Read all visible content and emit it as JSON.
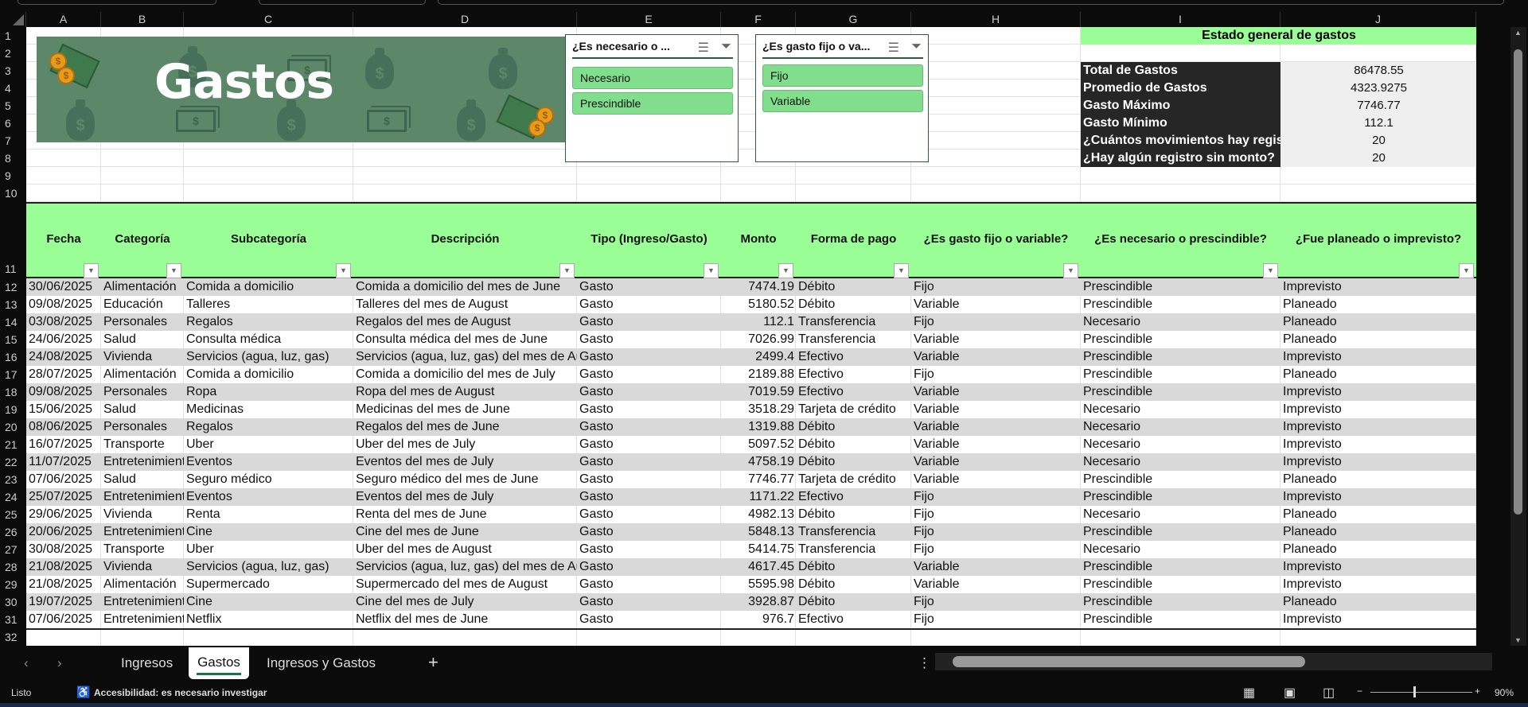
{
  "columns": [
    "A",
    "B",
    "C",
    "D",
    "E",
    "F",
    "G",
    "H",
    "I",
    "J"
  ],
  "rows_numbers": [
    "1",
    "2",
    "3",
    "4",
    "5",
    "6",
    "7",
    "8",
    "9",
    "10",
    "11",
    "12",
    "13",
    "14",
    "15",
    "16",
    "17",
    "18",
    "19",
    "20",
    "21",
    "22",
    "23",
    "24",
    "25",
    "26",
    "27",
    "28",
    "29",
    "30",
    "31",
    "32"
  ],
  "banner": {
    "title": "Gastos"
  },
  "slicer1": {
    "title": "¿Es necesario o ...",
    "items": [
      "Necesario",
      "Prescindible"
    ]
  },
  "slicer2": {
    "title": "¿Es gasto fijo o va...",
    "items": [
      "Fijo",
      "Variable"
    ]
  },
  "summary": {
    "title": "Estado general de gastos",
    "items": [
      {
        "label": "Total de Gastos",
        "value": "86478.55"
      },
      {
        "label": "Promedio de Gastos",
        "value": "4323.9275"
      },
      {
        "label": "Gasto Máximo",
        "value": "7746.77"
      },
      {
        "label": "Gasto Mínimo",
        "value": "112.1"
      },
      {
        "label": "¿Cuántos movimientos hay registrados?",
        "value": "20"
      },
      {
        "label": "¿Hay algún registro sin monto?",
        "value": "20"
      }
    ]
  },
  "table": {
    "headers": [
      "Fecha",
      "Categoría",
      "Subcategoría",
      "Descripción",
      "Tipo (Ingreso/Gasto)",
      "Monto",
      "Forma de pago",
      "¿Es gasto fijo o variable?",
      "¿Es necesario o prescindible?",
      "¿Fue planeado o imprevisto?"
    ],
    "rows": [
      [
        "30/06/2025",
        "Alimentación",
        "Comida a domicilio",
        "Comida a domicilio del mes de June",
        "Gasto",
        "7474.19",
        "Débito",
        "Fijo",
        "Prescindible",
        "Imprevisto"
      ],
      [
        "09/08/2025",
        "Educación",
        "Talleres",
        "Talleres del mes de August",
        "Gasto",
        "5180.52",
        "Débito",
        "Variable",
        "Prescindible",
        "Planeado"
      ],
      [
        "03/08/2025",
        "Personales",
        "Regalos",
        "Regalos del mes de August",
        "Gasto",
        "112.1",
        "Transferencia",
        "Fijo",
        "Necesario",
        "Planeado"
      ],
      [
        "24/06/2025",
        "Salud",
        "Consulta médica",
        "Consulta médica del mes de June",
        "Gasto",
        "7026.99",
        "Transferencia",
        "Variable",
        "Prescindible",
        "Planeado"
      ],
      [
        "24/08/2025",
        "Vivienda",
        "Servicios (agua, luz, gas)",
        "Servicios (agua, luz, gas) del mes de August",
        "Gasto",
        "2499.4",
        "Efectivo",
        "Variable",
        "Prescindible",
        "Imprevisto"
      ],
      [
        "28/07/2025",
        "Alimentación",
        "Comida a domicilio",
        "Comida a domicilio del mes de July",
        "Gasto",
        "2189.88",
        "Efectivo",
        "Fijo",
        "Prescindible",
        "Planeado"
      ],
      [
        "09/08/2025",
        "Personales",
        "Ropa",
        "Ropa del mes de August",
        "Gasto",
        "7019.59",
        "Efectivo",
        "Variable",
        "Prescindible",
        "Imprevisto"
      ],
      [
        "15/06/2025",
        "Salud",
        "Medicinas",
        "Medicinas del mes de June",
        "Gasto",
        "3518.29",
        "Tarjeta de crédito",
        "Variable",
        "Necesario",
        "Imprevisto"
      ],
      [
        "08/06/2025",
        "Personales",
        "Regalos",
        "Regalos del mes de June",
        "Gasto",
        "1319.88",
        "Débito",
        "Variable",
        "Necesario",
        "Imprevisto"
      ],
      [
        "16/07/2025",
        "Transporte",
        "Uber",
        "Uber del mes de July",
        "Gasto",
        "5097.52",
        "Débito",
        "Variable",
        "Necesario",
        "Imprevisto"
      ],
      [
        "11/07/2025",
        "Entretenimiento",
        "Eventos",
        "Eventos del mes de July",
        "Gasto",
        "4758.19",
        "Débito",
        "Variable",
        "Necesario",
        "Imprevisto"
      ],
      [
        "07/06/2025",
        "Salud",
        "Seguro médico",
        "Seguro médico del mes de June",
        "Gasto",
        "7746.77",
        "Tarjeta de crédito",
        "Variable",
        "Prescindible",
        "Planeado"
      ],
      [
        "25/07/2025",
        "Entretenimiento",
        "Eventos",
        "Eventos del mes de July",
        "Gasto",
        "1171.22",
        "Efectivo",
        "Fijo",
        "Prescindible",
        "Imprevisto"
      ],
      [
        "29/06/2025",
        "Vivienda",
        "Renta",
        "Renta del mes de June",
        "Gasto",
        "4982.13",
        "Débito",
        "Fijo",
        "Necesario",
        "Planeado"
      ],
      [
        "20/06/2025",
        "Entretenimiento",
        "Cine",
        "Cine del mes de June",
        "Gasto",
        "5848.13",
        "Transferencia",
        "Fijo",
        "Prescindible",
        "Planeado"
      ],
      [
        "30/08/2025",
        "Transporte",
        "Uber",
        "Uber del mes de August",
        "Gasto",
        "5414.75",
        "Transferencia",
        "Fijo",
        "Necesario",
        "Planeado"
      ],
      [
        "21/08/2025",
        "Vivienda",
        "Servicios (agua, luz, gas)",
        "Servicios (agua, luz, gas) del mes de August",
        "Gasto",
        "4617.45",
        "Débito",
        "Variable",
        "Prescindible",
        "Imprevisto"
      ],
      [
        "21/08/2025",
        "Alimentación",
        "Supermercado",
        "Supermercado del mes de August",
        "Gasto",
        "5595.98",
        "Débito",
        "Variable",
        "Prescindible",
        "Imprevisto"
      ],
      [
        "19/07/2025",
        "Entretenimiento",
        "Cine",
        "Cine del mes de July",
        "Gasto",
        "3928.87",
        "Débito",
        "Fijo",
        "Prescindible",
        "Planeado"
      ],
      [
        "07/06/2025",
        "Entretenimiento",
        "Netflix",
        "Netflix del mes de June",
        "Gasto",
        "976.7",
        "Efectivo",
        "Fijo",
        "Prescindible",
        "Imprevisto"
      ]
    ]
  },
  "sheet_tabs": [
    "Ingresos",
    "Gastos",
    "Ingresos y Gastos"
  ],
  "add_sheet": "+",
  "status": {
    "ready": "Listo",
    "accessibility": "Accesibilidad: es necesario investigar",
    "zoom": "90%"
  }
}
